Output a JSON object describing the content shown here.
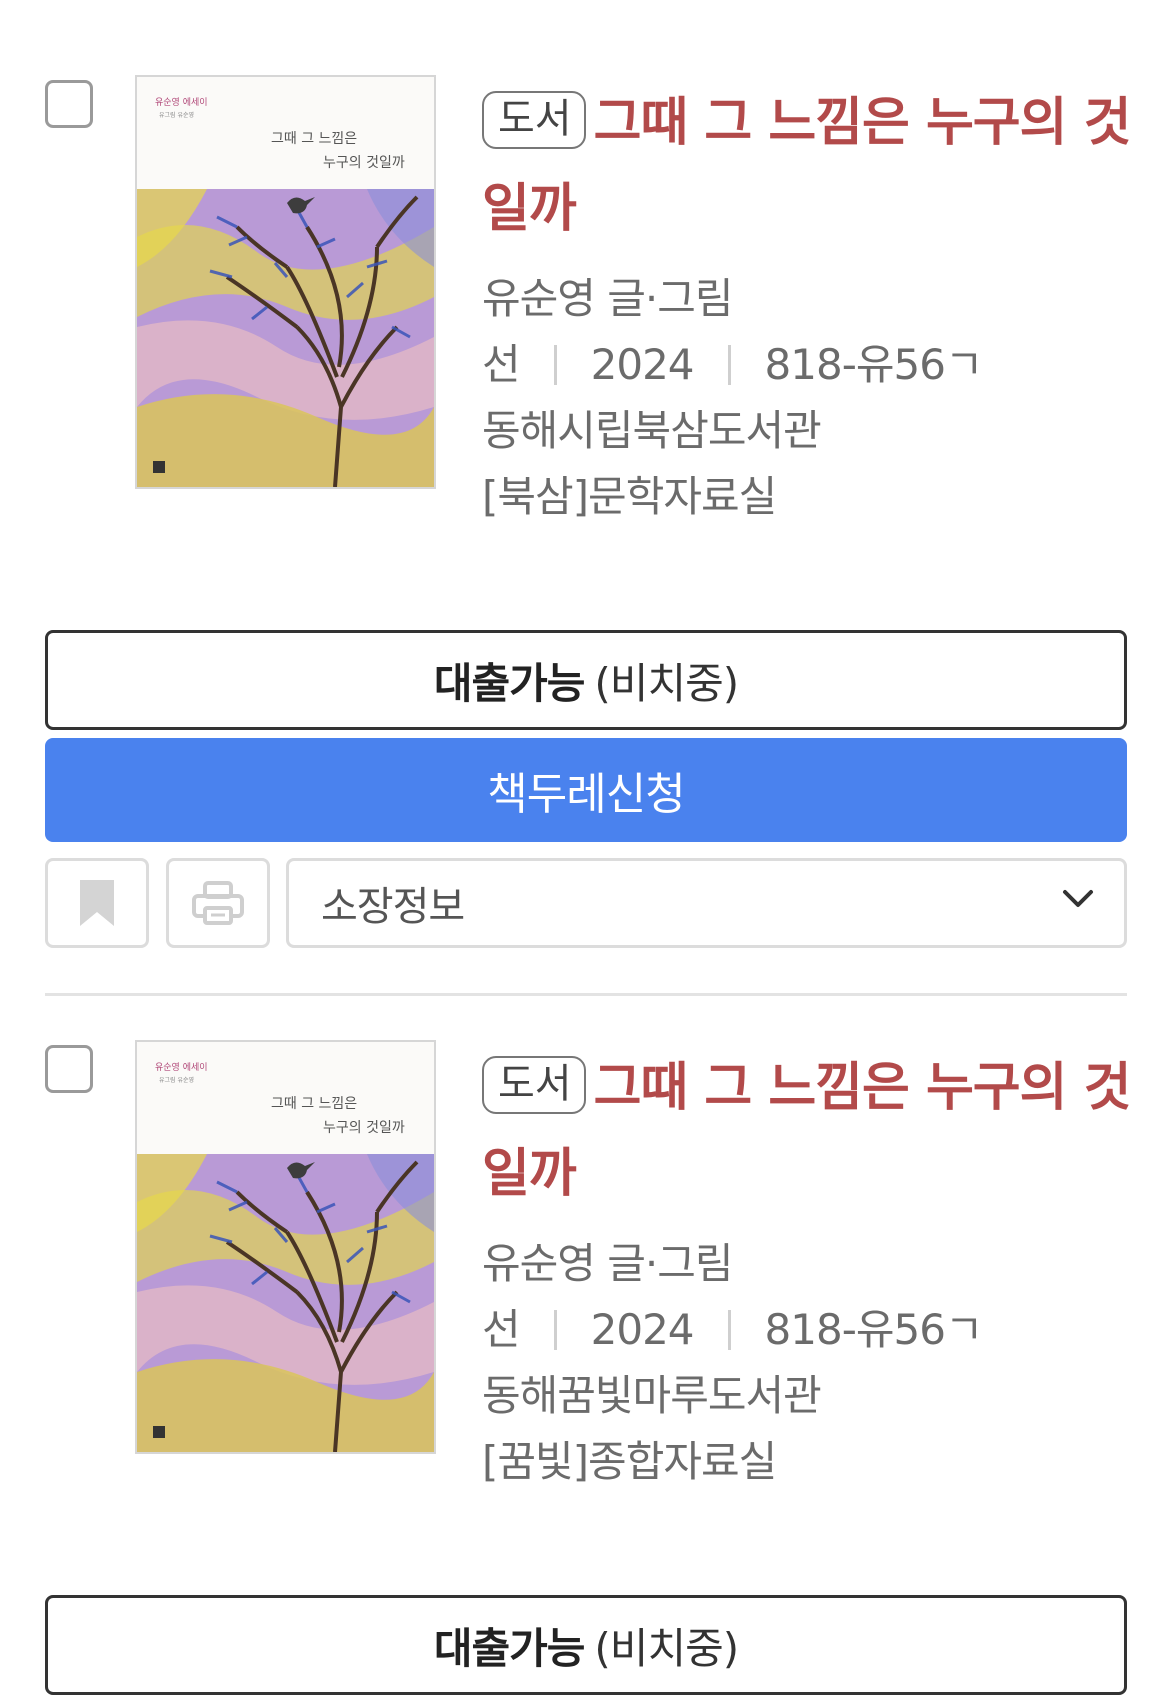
{
  "results": [
    {
      "type_badge": "도서",
      "title": "그때 그 느낌은 누구의 것일까",
      "author": "유순영 글·그림",
      "publisher": "선",
      "year": "2024",
      "call_number": "818-유56ㄱ",
      "library": "동해시립북삼도서관",
      "location": "[북삼]문학자료실",
      "cover": {
        "series_text": "유순영 에세이",
        "small_text": "유그림 유순영",
        "title_line1": "그때 그 느낌은",
        "title_line2": "누구의 것일까"
      },
      "availability_label": "대출가능",
      "availability_note": "(비치중)",
      "reserve_label": "책두레신청",
      "holdings_select_label": "소장정보"
    },
    {
      "type_badge": "도서",
      "title": "그때 그 느낌은 누구의 것일까",
      "author": "유순영 글·그림",
      "publisher": "선",
      "year": "2024",
      "call_number": "818-유56ㄱ",
      "library": "동해꿈빛마루도서관",
      "location": "[꿈빛]종합자료실",
      "cover": {
        "series_text": "유순영 에세이",
        "small_text": "유그림 유순영",
        "title_line1": "그때 그 느낌은",
        "title_line2": "누구의 것일까"
      },
      "availability_label": "대출가능",
      "availability_note": "(비치중)"
    }
  ],
  "colors": {
    "title": "#b24a4a",
    "primary_button": "#4a82ee",
    "meta_text": "#6b6b6b"
  },
  "icons": [
    "bookmark-icon",
    "print-icon",
    "chevron-down-icon"
  ]
}
